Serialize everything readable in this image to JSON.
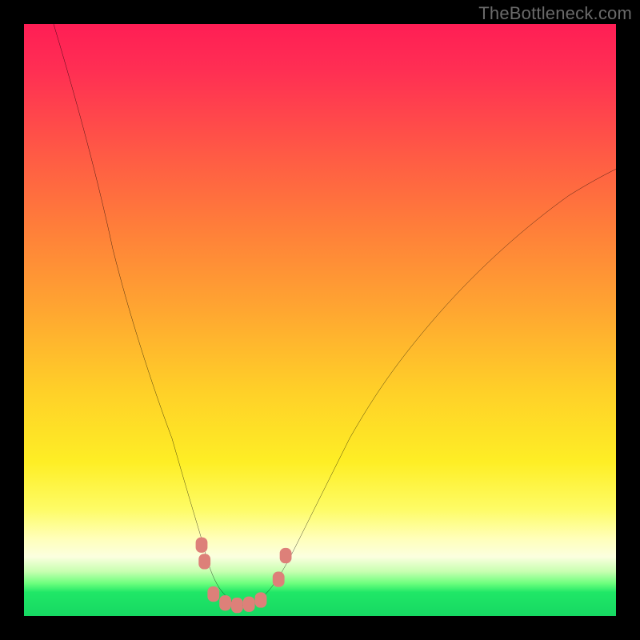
{
  "watermark": {
    "text": "TheBottleneck.com"
  },
  "chart_data": {
    "type": "line",
    "title": "",
    "xlabel": "",
    "ylabel": "",
    "xlim": [
      0,
      100
    ],
    "ylim": [
      0,
      100
    ],
    "grid": false,
    "legend": false,
    "background_gradient": {
      "stops": [
        {
          "pos": 0.0,
          "color": "#ff1e55"
        },
        {
          "pos": 0.22,
          "color": "#ff5a45"
        },
        {
          "pos": 0.48,
          "color": "#ffa531"
        },
        {
          "pos": 0.74,
          "color": "#feee25"
        },
        {
          "pos": 0.9,
          "color": "#fbffdf"
        },
        {
          "pos": 0.96,
          "color": "#20e767"
        },
        {
          "pos": 1.0,
          "color": "#16d862"
        }
      ]
    },
    "series": [
      {
        "name": "bottleneck-curve",
        "color": "#000000",
        "x": [
          5,
          10,
          15,
          20,
          25,
          28,
          30,
          32,
          34,
          36,
          38,
          40,
          43,
          46,
          50,
          55,
          62,
          70,
          80,
          90,
          100
        ],
        "y": [
          100,
          80,
          62,
          45,
          30,
          20,
          13,
          8,
          4,
          2,
          2,
          3,
          5,
          10,
          18,
          28,
          40,
          51,
          62,
          70,
          74
        ]
      }
    ],
    "markers": {
      "name": "trough-markers",
      "color": "#dd8079",
      "shape": "rounded-square",
      "points": [
        {
          "x": 30.0,
          "y": 12.0
        },
        {
          "x": 30.5,
          "y": 9.0
        },
        {
          "x": 32.0,
          "y": 3.5
        },
        {
          "x": 34.0,
          "y": 2.0
        },
        {
          "x": 36.0,
          "y": 1.8
        },
        {
          "x": 38.0,
          "y": 2.0
        },
        {
          "x": 40.0,
          "y": 2.5
        },
        {
          "x": 43.0,
          "y": 6.0
        },
        {
          "x": 44.0,
          "y": 10.0
        }
      ]
    }
  }
}
